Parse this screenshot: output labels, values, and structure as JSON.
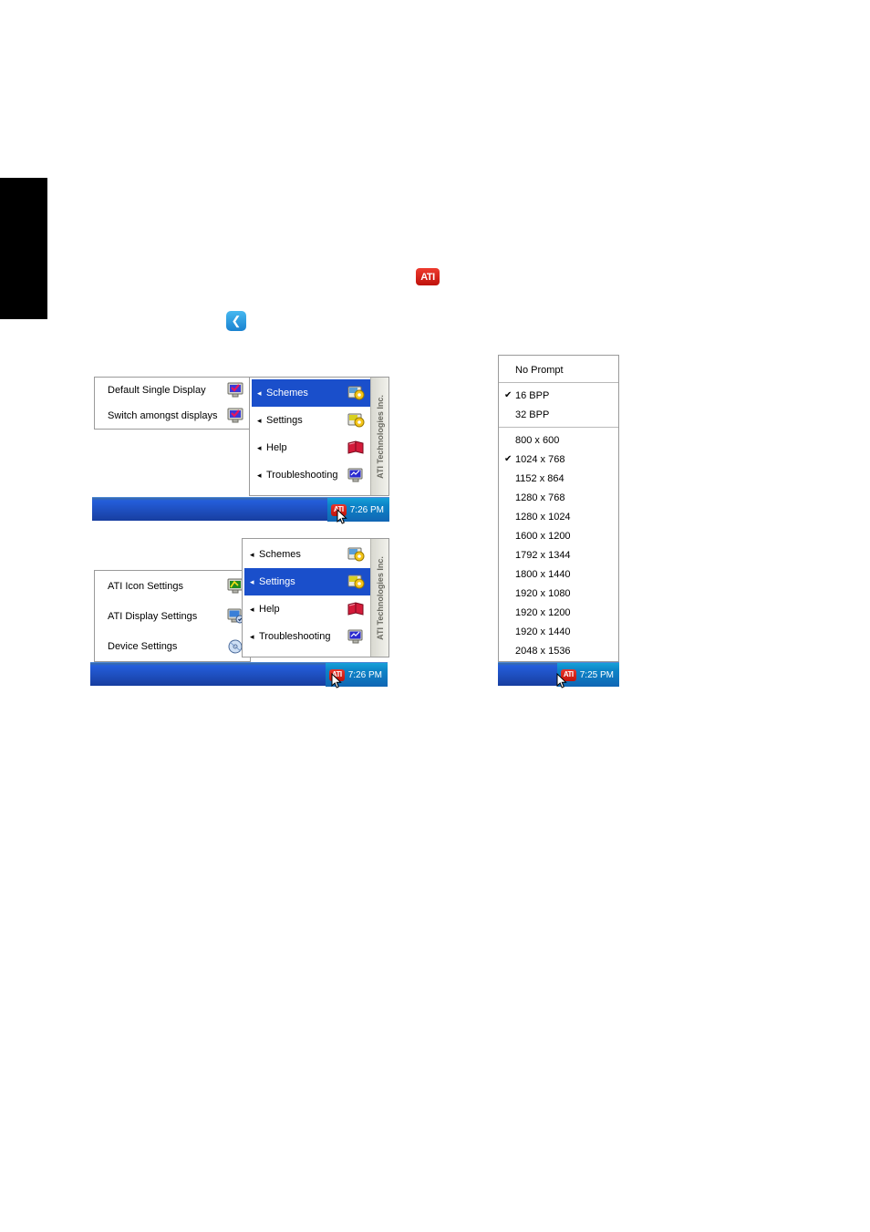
{
  "page": {
    "ati_logo_label": "ATI",
    "back_icon_label": "❮"
  },
  "menu_a": {
    "left_items": [
      {
        "label": "Default Single Display",
        "icon": "monitor-check-icon"
      },
      {
        "label": "Switch amongst displays",
        "icon": "monitor-check-icon"
      }
    ],
    "right_items": [
      {
        "label": "Schemes",
        "arrow": "◂",
        "icon": "schemes-icon",
        "selected": true
      },
      {
        "label": "Settings",
        "arrow": "◂",
        "icon": "settings-icon",
        "selected": false
      },
      {
        "label": "Help",
        "arrow": "◂",
        "icon": "help-book-icon",
        "selected": false
      },
      {
        "label": "Troubleshooting",
        "arrow": "◂",
        "icon": "troubleshooting-icon",
        "selected": false
      }
    ],
    "banner_text": "ATI Technologies Inc.",
    "taskbar": {
      "clock": "7:26 PM",
      "tray_icon": "ati-tray-icon"
    }
  },
  "menu_b": {
    "left_items": [
      {
        "label": "ATI Icon Settings",
        "icon": "monitor-green-icon"
      },
      {
        "label": "ATI Display Settings",
        "icon": "monitor-blue-icon"
      },
      {
        "label": "Device Settings",
        "icon": "device-disc-icon"
      }
    ],
    "right_items": [
      {
        "label": "Schemes",
        "arrow": "◂",
        "icon": "schemes-icon",
        "selected": false
      },
      {
        "label": "Settings",
        "arrow": "◂",
        "icon": "settings-icon",
        "selected": true
      },
      {
        "label": "Help",
        "arrow": "◂",
        "icon": "help-book-icon",
        "selected": false
      },
      {
        "label": "Troubleshooting",
        "arrow": "◂",
        "icon": "troubleshooting-icon",
        "selected": false
      }
    ],
    "banner_text": "ATI Technologies Inc.",
    "taskbar": {
      "clock": "7:26 PM",
      "tray_icon": "ati-tray-icon"
    }
  },
  "menu_c": {
    "groups": [
      {
        "items": [
          {
            "label": "No Prompt",
            "checked": false
          }
        ]
      },
      {
        "items": [
          {
            "label": "16 BPP",
            "checked": true
          },
          {
            "label": "32 BPP",
            "checked": false
          }
        ]
      },
      {
        "items": [
          {
            "label": "800 x 600",
            "checked": false
          },
          {
            "label": "1024 x 768",
            "checked": true
          },
          {
            "label": "1152 x 864",
            "checked": false
          },
          {
            "label": "1280 x 768",
            "checked": false
          },
          {
            "label": "1280 x 1024",
            "checked": false
          },
          {
            "label": "1600 x 1200",
            "checked": false
          },
          {
            "label": "1792 x 1344",
            "checked": false
          },
          {
            "label": "1800 x 1440",
            "checked": false
          },
          {
            "label": "1920 x 1080",
            "checked": false
          },
          {
            "label": "1920 x 1200",
            "checked": false
          },
          {
            "label": "1920 x 1440",
            "checked": false
          },
          {
            "label": "2048 x 1536",
            "checked": false
          }
        ]
      }
    ],
    "taskbar": {
      "clock": "7:25 PM",
      "tray_icon": "ati-tray-icon"
    },
    "check_glyph": "✔"
  }
}
